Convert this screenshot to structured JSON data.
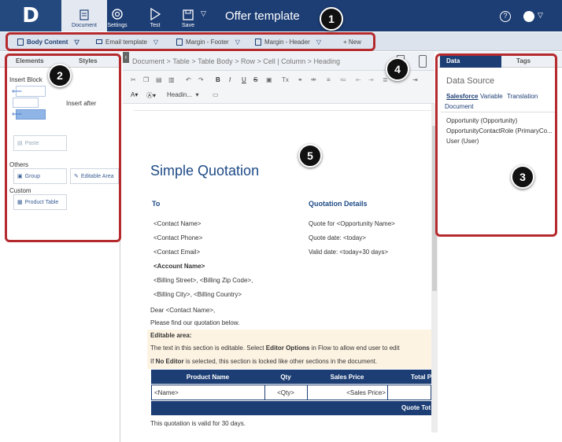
{
  "header": {
    "logo": "D",
    "toolbar": [
      {
        "label": "Document",
        "icon": "document-icon"
      },
      {
        "label": "Settings",
        "icon": "gear-icon"
      },
      {
        "label": "Test",
        "icon": "play-icon"
      },
      {
        "label": "Save",
        "icon": "save-icon"
      }
    ],
    "title": "Offer template",
    "help": "?"
  },
  "tabs": [
    {
      "label": "Body Content"
    },
    {
      "label": "Email template"
    },
    {
      "label": "Margin - Footer"
    },
    {
      "label": "Margin - Header"
    },
    {
      "label": "+ New"
    }
  ],
  "left_panel": {
    "tabs": [
      "Elements",
      "Styles"
    ],
    "insert_block": "Insert Block",
    "insert_after": "Insert after",
    "paste": "Paste",
    "others_label": "Others",
    "group": "Group",
    "editable_area": "Editable Area",
    "custom_label": "Custom",
    "product_table": "Product Table"
  },
  "breadcrumb": [
    "Document",
    ">",
    "Table",
    ">",
    "Table Body",
    ">",
    "Row",
    ">",
    "Cell | Column",
    ">",
    "Heading"
  ],
  "format_dropdown": "Headin...",
  "document": {
    "title": "Simple Quotation",
    "to_heading": "To",
    "details_heading": "Quotation Details",
    "to_lines": [
      "<Contact Name>",
      "<Contact Phone>",
      "<Contact Email>",
      "<Account Name>",
      "<Billing Street>, <Billing Zip Code>,",
      "<Billing City>, <Billing Country>"
    ],
    "details_lines": [
      "Quote for <Opportunity Name>",
      "Quote date: <today>",
      "Valid date: <today+30 days>"
    ],
    "greeting": "Dear <Contact Name>,",
    "intro": "Please find our quotation below.",
    "editable_title": "Editable area:",
    "editable_line1_a": "The text in this section is editable. Select ",
    "editable_line1_b": "Editor Options",
    "editable_line1_c": " in Flow to allow end user to edit",
    "editable_line2_a": "If ",
    "editable_line2_b": "No Editor",
    "editable_line2_c": " is selected, this section is locked like other sections in the document.",
    "table_headers": [
      "Product Name",
      "Qty",
      "Sales Price",
      "Total P"
    ],
    "table_row": [
      "<Name>",
      "<Qty>",
      "<Sales Price>",
      ""
    ],
    "quote_total": "Quote Tot",
    "footer": "This quotation is valid for 30 days."
  },
  "right_panel": {
    "tabs": [
      "Data",
      "Tags"
    ],
    "title": "Data Source",
    "subtabs": [
      "Salesforce",
      "Variable",
      "Translation"
    ],
    "document_link": "Document",
    "items": [
      "Opportunity (Opportunity)",
      "OpportunityContactRole (PrimaryCo...",
      "User (User)"
    ]
  },
  "callouts": [
    "1",
    "2",
    "3",
    "4",
    "5"
  ],
  "colors": {
    "brand": "#1d3e74",
    "highlight": "#b52a2e",
    "editable_bg": "#fdf3e3"
  }
}
